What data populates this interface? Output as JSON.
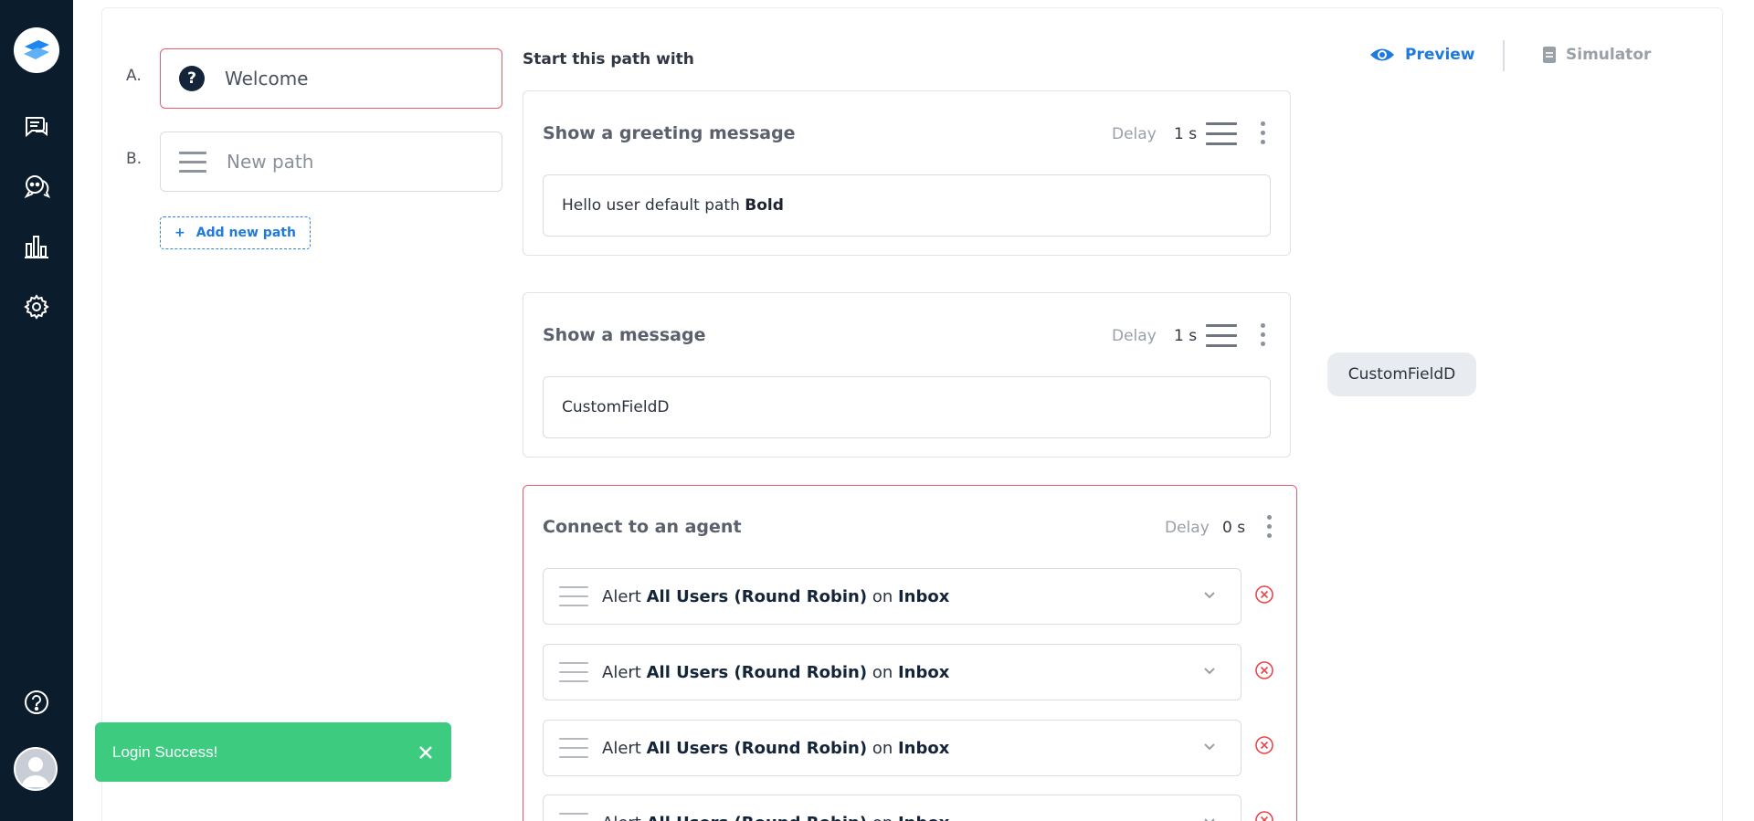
{
  "paths": [
    {
      "letter": "A.",
      "label": "Welcome"
    },
    {
      "letter": "B.",
      "label": "New path"
    }
  ],
  "add_path_label": "Add new path",
  "editor": {
    "start_title": "Start this path with",
    "greeting_card": {
      "title": "Show a greeting message",
      "delay_label": "Delay",
      "delay_value": "1 s",
      "message_text": "Hello user default path ",
      "message_bold": "Bold"
    },
    "message_card": {
      "title": "Show a message",
      "delay_label": "Delay",
      "delay_value": "1 s",
      "message_text": "CustomFieldD"
    },
    "agent_card": {
      "title": "Connect to an agent",
      "delay_label": "Delay",
      "delay_value": "0 s",
      "alerts": [
        {
          "prefix": "Alert",
          "users": "All Users (Round Robin)",
          "on": "on",
          "channel": "Inbox"
        },
        {
          "prefix": "Alert",
          "users": "All Users (Round Robin)",
          "on": "on",
          "channel": "Inbox"
        },
        {
          "prefix": "Alert",
          "users": "All Users (Round Robin)",
          "on": "on",
          "channel": "Inbox"
        },
        {
          "prefix": "Alert",
          "users": "All Users (Round Robin)",
          "on": "on",
          "channel": "Inbox"
        }
      ]
    }
  },
  "preview": {
    "tabs": {
      "preview": "Preview",
      "simulator": "Simulator"
    },
    "bubble_text": "CustomFieldD"
  },
  "toast": {
    "message": "Login Success!"
  },
  "sidebar": {
    "icons": [
      "logo-icon",
      "chat-icon",
      "bot-chat-icon",
      "analytics-icon",
      "settings-icon",
      "help-icon",
      "avatar-icon"
    ]
  },
  "colors": {
    "sidebar": "#0b1c2c",
    "accent": "#1f7ae0",
    "active_border": "#e95d6c",
    "toast": "#3ccb7f",
    "remove": "#e5484d"
  }
}
